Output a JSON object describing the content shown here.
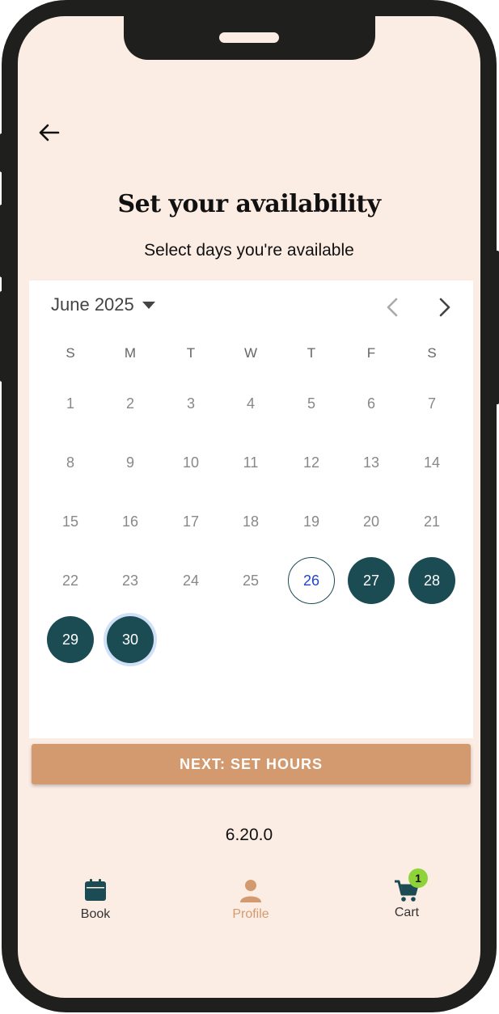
{
  "header": {
    "title": "Set your availability",
    "subtitle": "Select days you're available"
  },
  "calendar": {
    "month_label": "June 2025",
    "weekdays": [
      "S",
      "M",
      "T",
      "W",
      "T",
      "F",
      "S"
    ],
    "days": [
      "1",
      "2",
      "3",
      "4",
      "5",
      "6",
      "7",
      "8",
      "9",
      "10",
      "11",
      "12",
      "13",
      "14",
      "15",
      "16",
      "17",
      "18",
      "19",
      "20",
      "21",
      "22",
      "23",
      "24",
      "25",
      "26",
      "27",
      "28",
      "29",
      "30"
    ],
    "today": "26",
    "selected_days": [
      "27",
      "28",
      "29",
      "30"
    ],
    "focused_day": "30"
  },
  "actions": {
    "next_label": "NEXT: SET HOURS"
  },
  "version": "6.20.0",
  "bottom_nav": {
    "items": [
      {
        "label": "Book",
        "icon": "calendar-icon",
        "active": false
      },
      {
        "label": "Profile",
        "icon": "person-icon",
        "active": true
      },
      {
        "label": "Cart",
        "icon": "cart-icon",
        "active": false,
        "badge": "1"
      }
    ]
  },
  "colors": {
    "background": "#fcede4",
    "primary": "#1b4c54",
    "accent": "#d39a6f",
    "badge": "#8fd33b",
    "today_text": "#2244cc"
  }
}
